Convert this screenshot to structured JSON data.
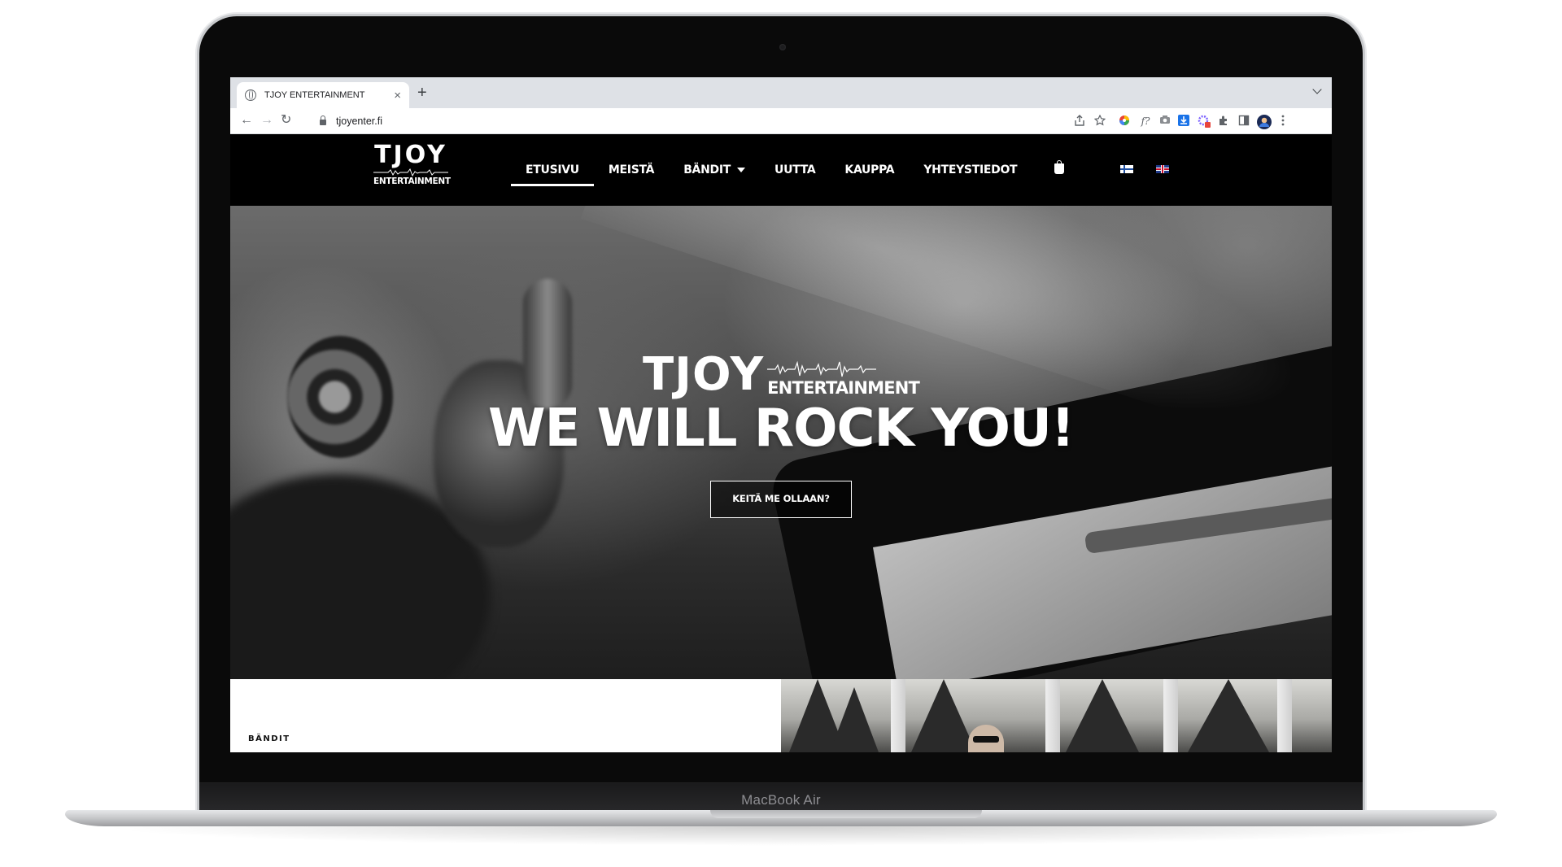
{
  "device": {
    "label": "MacBook Air"
  },
  "browser": {
    "tab_title": "TJOY ENTERTAINMENT",
    "tab_close": "×",
    "new_tab": "+",
    "url": "tjoyenter.fi",
    "nav": {
      "back": "←",
      "forward": "→",
      "reload": "↻"
    },
    "toolbar_icons": [
      "share-icon",
      "bookmark-star-icon",
      "color-picker-extension-icon",
      "font-inspector-extension-icon",
      "camera-extension-icon",
      "download-extension-icon",
      "settings-extension-icon",
      "extensions-puzzle-icon",
      "side-panel-icon",
      "profile-avatar",
      "menu-dots-icon"
    ],
    "font_ext_label": "f?"
  },
  "site": {
    "logo": {
      "main": "TJOY",
      "sub": "ENTERTAINMENT"
    },
    "nav": [
      {
        "label": "ETUSIVU",
        "active": true
      },
      {
        "label": "MEISTÄ"
      },
      {
        "label": "BÄNDIT",
        "has_dropdown": true
      },
      {
        "label": "UUTTA"
      },
      {
        "label": "KAUPPA"
      },
      {
        "label": "YHTEYSTIEDOT"
      }
    ],
    "languages": [
      "fi",
      "en"
    ]
  },
  "hero": {
    "logo_main": "TJOY",
    "logo_sub": "ENTERTAINMENT",
    "title": "WE WILL ROCK YOU!",
    "button": "KEITÄ ME OLLAAN?"
  },
  "sections": {
    "bands_label": "BÄNDIT"
  },
  "colors": {
    "header_bg": "#000000",
    "text": "#ffffff",
    "tabbar": "#dee1e6"
  }
}
